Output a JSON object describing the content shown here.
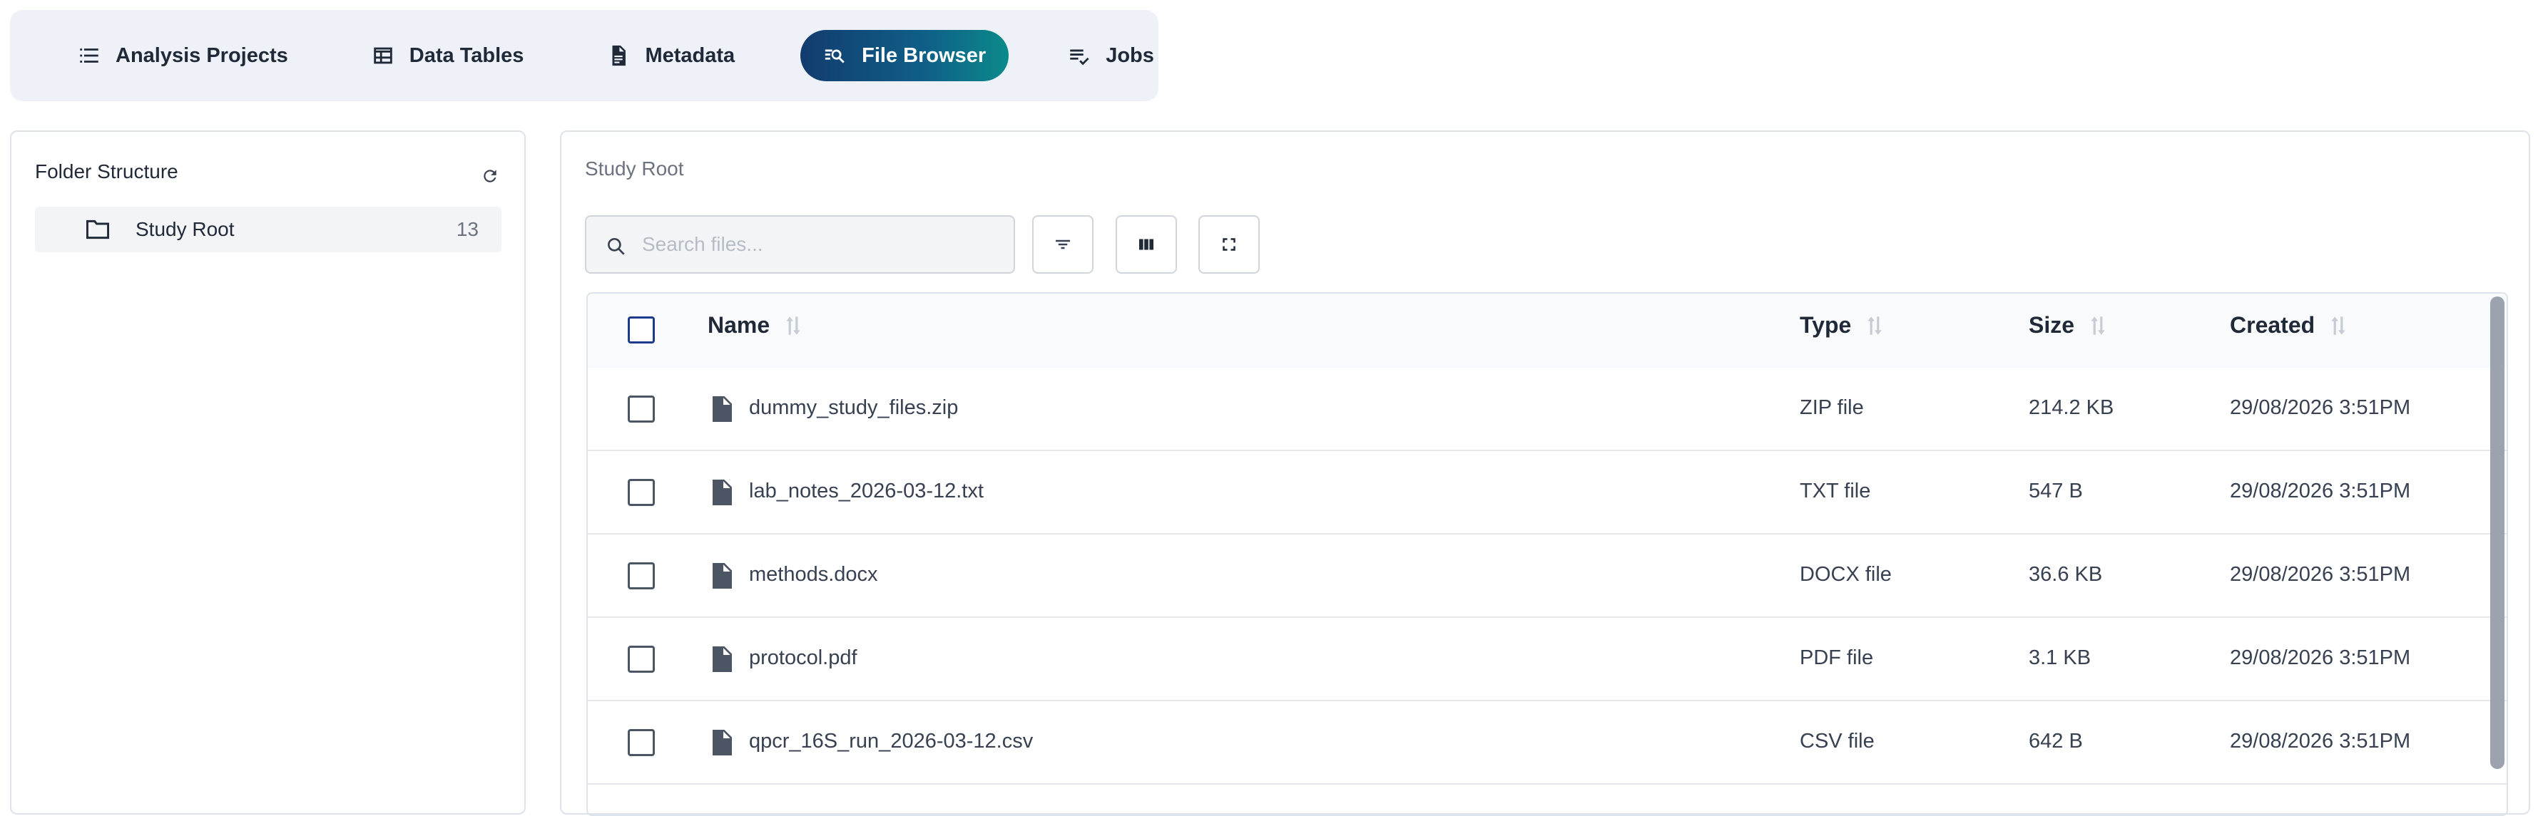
{
  "nav": {
    "items": [
      {
        "label": "Analysis Projects",
        "icon": "list-icon",
        "active": false
      },
      {
        "label": "Data Tables",
        "icon": "table-icon",
        "active": false
      },
      {
        "label": "Metadata",
        "icon": "document-icon",
        "active": false
      },
      {
        "label": "File Browser",
        "icon": "search-list-icon",
        "active": true
      },
      {
        "label": "Jobs",
        "icon": "checklist-icon",
        "active": false
      }
    ],
    "active_gradient": [
      "#123c6e",
      "#0b8a8a"
    ]
  },
  "folders": {
    "title": "Folder Structure",
    "refresh_icon": "refresh-icon",
    "items": [
      {
        "label": "Study Root",
        "count": "13",
        "icon": "folder-icon"
      }
    ]
  },
  "main": {
    "breadcrumb": "Study Root",
    "search": {
      "placeholder": "Search files...",
      "value": "",
      "icon": "search-icon"
    },
    "toolbar": {
      "filter_icon": "filter-icon",
      "columns_icon": "columns-icon",
      "fullscreen_icon": "fullscreen-icon"
    },
    "table": {
      "columns": [
        "Name",
        "Type",
        "Size",
        "Created"
      ],
      "rows": [
        {
          "name": "dummy_study_files.zip",
          "type": "ZIP file",
          "size": "214.2 KB",
          "created": "29/08/2026 3:51PM"
        },
        {
          "name": "lab_notes_2026-03-12.txt",
          "type": "TXT file",
          "size": "547 B",
          "created": "29/08/2026 3:51PM"
        },
        {
          "name": "methods.docx",
          "type": "DOCX file",
          "size": "36.6 KB",
          "created": "29/08/2026 3:51PM"
        },
        {
          "name": "protocol.pdf",
          "type": "PDF file",
          "size": "3.1 KB",
          "created": "29/08/2026 3:51PM"
        },
        {
          "name": "qpcr_16S_run_2026-03-12.csv",
          "type": "CSV file",
          "size": "642 B",
          "created": "29/08/2026 3:51PM"
        }
      ]
    }
  }
}
